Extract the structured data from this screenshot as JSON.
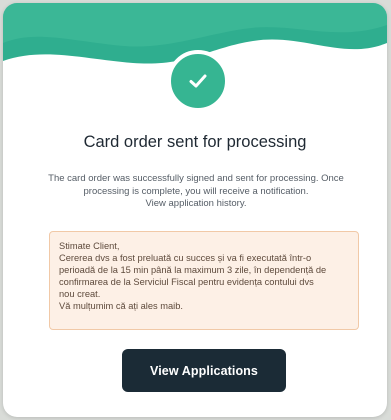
{
  "dialog": {
    "title": "Card order sent for processing",
    "message_lines": [
      "The card order was successfully signed and sent for processing. Once",
      "processing is complete, you will receive a notification.",
      "View application history."
    ],
    "notice_lines": [
      "Stimate Client,",
      "Cererea dvs a fost preluată cu succes și va fi executată într-o",
      "perioadă de la 15 min până la maximum 3 zile, în dependență de",
      "confirmarea de la Serviciul Fiscal pentru evidența contului dvs",
      "nou creat.",
      "Vă mulțumim că ați ales maib."
    ],
    "primary_button_label": "View Applications",
    "status_icon": "check-icon"
  },
  "colors": {
    "accent_green": "#36b592",
    "header_green": "#2fae8f",
    "button_dark": "#1b2b36",
    "notice_background": "#fdf0e6",
    "notice_border": "#f1c9a7"
  }
}
